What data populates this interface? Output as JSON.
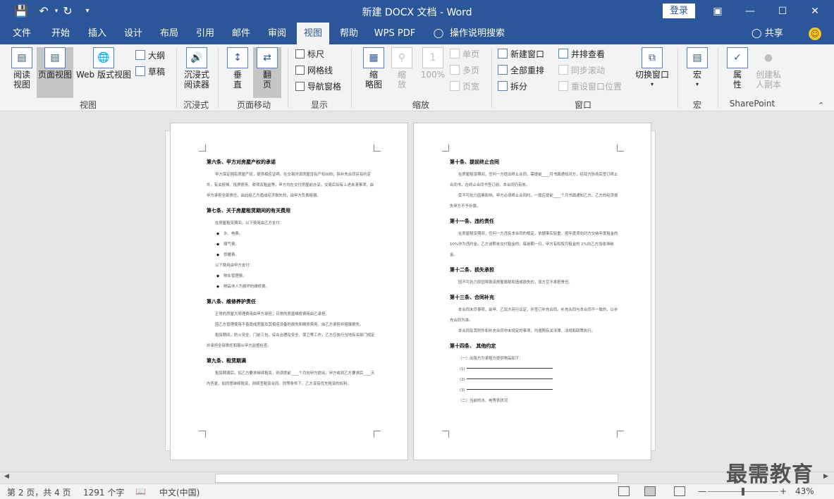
{
  "titlebar": {
    "title": "新建 DOCX 文档  -  Word",
    "login": "登录",
    "icons": [
      "save-icon",
      "undo-icon",
      "redo-icon",
      "customize-icon"
    ]
  },
  "tabs": [
    "文件",
    "开始",
    "插入",
    "设计",
    "布局",
    "引用",
    "邮件",
    "审阅",
    "视图",
    "帮助",
    "WPS PDF",
    "操作说明搜索"
  ],
  "active_tab": "视图",
  "share": "共享",
  "ribbon": {
    "views": {
      "label": "视图",
      "read": "阅读\n视图",
      "print": "页面视图",
      "web": "Web 版式视图",
      "outline": "大纲",
      "draft": "草稿"
    },
    "immersive": {
      "label": "沉浸式",
      "reader": "沉浸式\n阅读器"
    },
    "pagemove": {
      "label": "页面移动",
      "vertical": "垂\n直",
      "flip": "翻\n页"
    },
    "show": {
      "label": "显示",
      "ruler": "标尺",
      "grid": "网格线",
      "nav": "导航窗格"
    },
    "zoom": {
      "label": "缩放",
      "zoom": "缩\n放",
      "zoompage": "缩\n略图",
      "pct": "100%",
      "one": "单页",
      "multi": "多页",
      "width": "页宽"
    },
    "window": {
      "label": "窗口",
      "new": "新建窗口",
      "arrange": "全部重排",
      "split": "拆分",
      "side": "并排查看",
      "sync": "同步滚动",
      "reset": "重设窗口位置",
      "switch": "切换窗口"
    },
    "macro": {
      "label": "宏",
      "macro": "宏"
    },
    "sharepoint": {
      "label": "SharePoint",
      "props": "属\n性",
      "copy": "创建私\n人副本"
    }
  },
  "page_left": {
    "s6_title": "第六条、甲方对房屋产权的承诺",
    "s6_p1": "甲方保证拥有房屋产权，提供相应证明。在交易时该房屋没有产权纠纷；除补充合同另有约定外，有关按揭、抵押债务、税项及租金等，甲方均在交付房屋前办妥。交易后如有上述未清事项，由甲方承担全部责任，由此给乙方造成经济损失的，由甲方负责赔偿。",
    "s7_title": "第七条、关于房屋租赁期间的有关费用",
    "s7_intro": "在房屋租赁期间，以下费用由乙方支付：",
    "s7_b1": "水、电费。",
    "s7_b2": "煤气费。",
    "s7_b3": "供暖费。",
    "s7_mid": "以下费用由甲方支付：",
    "s7_b4": "物业管理费。",
    "s7_b5": "物品非人为损坏的维修费。",
    "s8_title": "第八条、维修养护责任",
    "s8_p1": "正常的房屋大修理费用由甲方承担；日常的房屋维修费用由乙承担。",
    "s8_p2": "因乙方管理使用不善造成房屋及其相连设备的损失和维修费用，由乙方承担并赔偿损失。",
    "s8_p3": "租赁期间，防火安全，门前三包，综合治理及安全、保卫等工作，乙方应执行当地有关部门规定并承担全部责任和服从甲方监督检查。",
    "s9_title": "第九条、租赁期满",
    "s9_p1": "租赁期满后，如乙方要求继续租赁，则须提前____个月向甲方提出，甲方收到乙方要求后____天内答复。如同意继续租赁，则续签租赁合同。同等条件下，乙方享有优先租赁的权利。"
  },
  "page_right": {
    "s10_title": "第十条、提前终止合同",
    "s10_p1": "在房屋租赁期间，任何一方提出终止合同，需提前____月书面通知对方，经双方协商后签订终止合同书，在终止合同书签订前，本合同仍有效。",
    "s10_p2": "受不可抗力因素影响，甲方必须终止合同时，一般应提前____个月书面通知乙方。乙方的经济损失甲方不予补偿。",
    "s11_title": "第十一条、违约责任",
    "s11_p1": "在房屋租赁期间，任何一方违反本合同的规定，依据事实轻重，按年度须向对方交纳年度租金的 10%作为违约金。乙方逾期未交付租金的，每逾期一日，甲方有权按月租金的 2%向乙方加收滞纳金。",
    "s12_title": "第十二条、损失承担",
    "s12_p1": "因不可抗力原因导致该房屋毁损和造成损失的，双方互不承担责任。",
    "s13_title": "第十三条、合同补充",
    "s13_p1": "本合同未尽事项，由甲、乙双方另行议定，并签订补充合同。补充合同与本合同不一致的，以补充合同为准。",
    "s13_p2": "本合同及其附件和补充合同中未规定的事项，均遵照有关法律、法规和政策执行。",
    "s14_title": "第十四条、 其他约定",
    "s14_p1": "（一）出租方为承租方提供物品如下：",
    "l1": "(1)",
    "l2": "(2)",
    "l3": "(3)",
    "s14_p2": "（二）当前的水、电等表状况："
  },
  "status": {
    "page": "第 2 页，共 4 页",
    "words": "1291 个字",
    "lang": "中文(中国)",
    "zoom": "43%"
  },
  "watermark": "最需教育"
}
